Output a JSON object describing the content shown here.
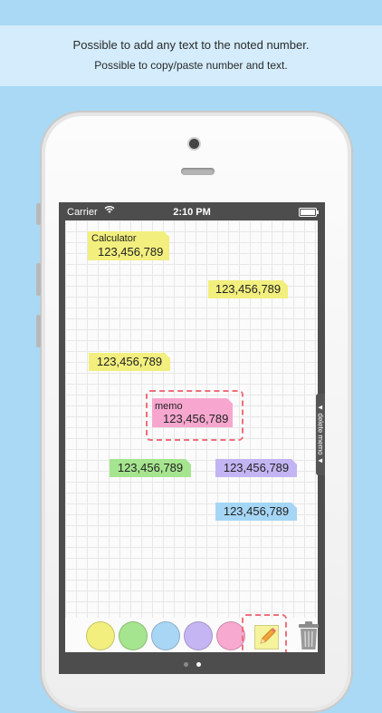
{
  "banner": {
    "line1": "Possible to add any text to the noted number.",
    "line2": "Possible to copy/paste number and text."
  },
  "statusbar": {
    "carrier": "Carrier",
    "time": "2:10 PM",
    "wifi_icon": "wifi-icon",
    "battery_icon": "battery-icon"
  },
  "notes": [
    {
      "label": "Calculator",
      "value": "123,456,789",
      "color": "#f2ef7e"
    },
    {
      "label": "",
      "value": "123,456,789",
      "color": "#f2ef7e"
    },
    {
      "label": "",
      "value": "123,456,789",
      "color": "#f2ef7e"
    },
    {
      "label": "memo",
      "value": "123,456,789",
      "color": "#f7a7cf",
      "selected": true
    },
    {
      "label": "",
      "value": "123,456,789",
      "color": "#a6e58f"
    },
    {
      "label": "",
      "value": "123,456,789",
      "color": "#c3b5f3"
    },
    {
      "label": "",
      "value": "123,456,789",
      "color": "#a6d6f5"
    }
  ],
  "drawer": {
    "label": "▼ delete memo ▼"
  },
  "toolbar": {
    "colors": [
      {
        "name": "yellow",
        "hex": "#f2ef7e"
      },
      {
        "name": "green",
        "hex": "#a6e58f"
      },
      {
        "name": "blue",
        "hex": "#a9d6f5"
      },
      {
        "name": "purple",
        "hex": "#c6b5f3"
      },
      {
        "name": "pink",
        "hex": "#f7a9d0"
      }
    ],
    "new_memo_icon": "pencil-icon",
    "trash_icon": "trash-icon"
  },
  "page_indicator": {
    "pages": 2,
    "current": 2
  }
}
